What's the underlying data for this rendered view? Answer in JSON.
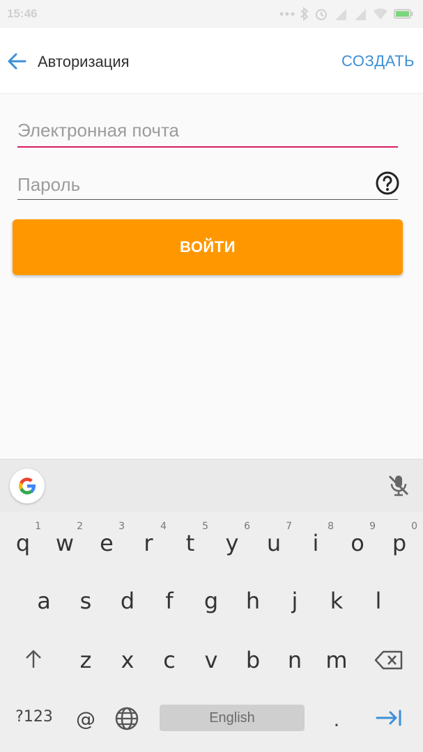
{
  "status_bar": {
    "time": "15:46"
  },
  "app_bar": {
    "title": "Авторизация",
    "create_label": "СОЗДАТЬ"
  },
  "form": {
    "email_placeholder": "Электронная почта",
    "password_placeholder": "Пароль",
    "login_label": "ВОЙТИ"
  },
  "keyboard": {
    "row1": [
      {
        "key": "q",
        "num": "1"
      },
      {
        "key": "w",
        "num": "2"
      },
      {
        "key": "e",
        "num": "3"
      },
      {
        "key": "r",
        "num": "4"
      },
      {
        "key": "t",
        "num": "5"
      },
      {
        "key": "y",
        "num": "6"
      },
      {
        "key": "u",
        "num": "7"
      },
      {
        "key": "i",
        "num": "8"
      },
      {
        "key": "o",
        "num": "9"
      },
      {
        "key": "p",
        "num": "0"
      }
    ],
    "row2": [
      "a",
      "s",
      "d",
      "f",
      "g",
      "h",
      "j",
      "k",
      "l"
    ],
    "row3": [
      "z",
      "x",
      "c",
      "v",
      "b",
      "n",
      "m"
    ],
    "symbols_label": "?123",
    "at_label": "@",
    "space_label": "English",
    "period_label": "."
  },
  "colors": {
    "accent": "#ff9800",
    "link": "#3d8fd8",
    "focus_underline": "#d81b60"
  }
}
